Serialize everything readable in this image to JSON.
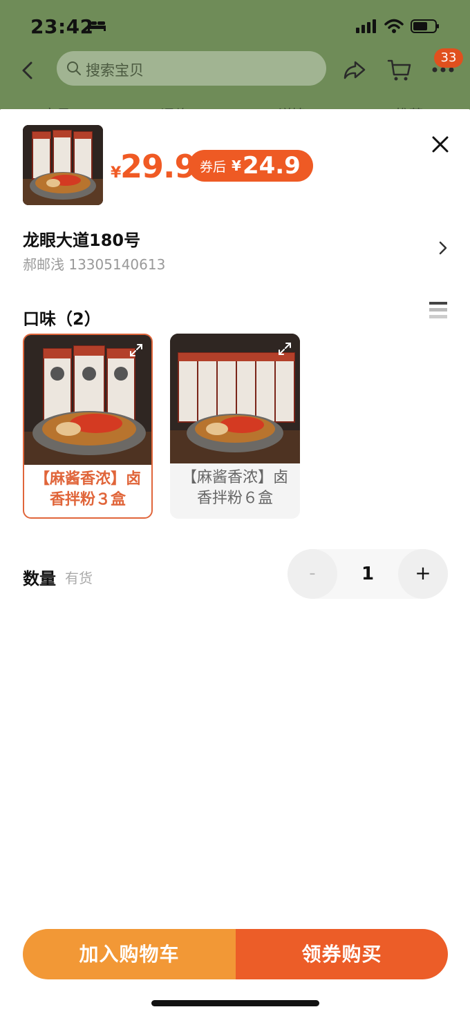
{
  "status_bar": {
    "time": "23:42"
  },
  "nav": {
    "search_placeholder": "搜索宝贝",
    "badge_count": "33",
    "tabs_peek": [
      "宝贝",
      "评价",
      "详情",
      "推荐"
    ]
  },
  "product": {
    "price_symbol": "¥",
    "price": "29.9",
    "coupon_label": "券后",
    "coupon_symbol": "¥",
    "coupon_price": "24.9"
  },
  "address": {
    "line": "龙眼大道180号",
    "contact": "郝邮浅 13305140613"
  },
  "flavor": {
    "title": "口味（2）",
    "options": [
      {
        "label": "【麻酱香浓】卤香拌粉３盒",
        "selected": true
      },
      {
        "label": "【麻酱香浓】卤香拌粉６盒",
        "selected": false
      }
    ]
  },
  "quantity": {
    "label": "数量",
    "stock": "有货",
    "minus": "-",
    "value": "1",
    "plus": "+"
  },
  "actions": {
    "add_to_cart": "加入购物车",
    "buy_with_coupon": "领券购买"
  },
  "colors": {
    "accent_orange": "#f05a24",
    "add_cart_orange": "#f29836",
    "backdrop_green": "#6f8c58"
  }
}
